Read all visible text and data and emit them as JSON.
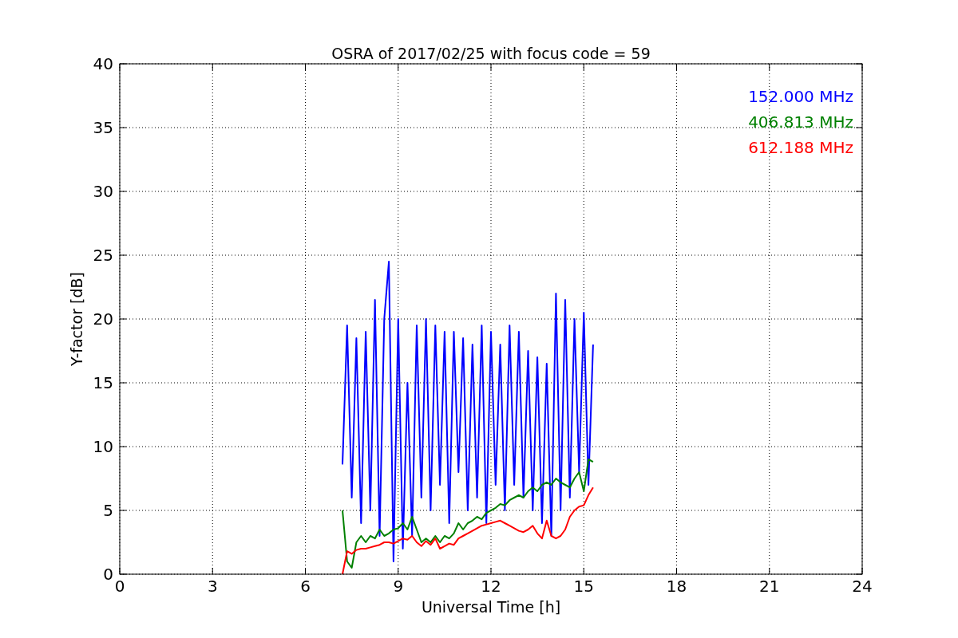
{
  "chart_data": {
    "type": "line",
    "title": "OSRA of 2017/02/25 with focus code = 59",
    "xlabel": "Universal Time [h]",
    "ylabel": "Y-factor [dB]",
    "x": [
      7.2,
      7.35,
      7.5,
      7.65,
      7.8,
      7.95,
      8.1,
      8.25,
      8.4,
      8.55,
      8.7,
      8.85,
      9,
      9.15,
      9.3,
      9.45,
      9.6,
      9.75,
      9.9,
      10.05,
      10.2,
      10.35,
      10.5,
      10.65,
      10.8,
      10.95,
      11.1,
      11.25,
      11.4,
      11.55,
      11.7,
      11.85,
      12,
      12.15,
      12.3,
      12.45,
      12.6,
      12.75,
      12.9,
      13.05,
      13.2,
      13.35,
      13.5,
      13.65,
      13.8,
      13.95,
      14.1,
      14.25,
      14.4,
      14.55,
      14.7,
      14.85,
      15,
      15.15,
      15.3
    ],
    "series": [
      {
        "name": "152.000 MHz",
        "color": "#0000ff",
        "values": [
          8.6,
          19.5,
          6,
          18.5,
          4,
          19,
          5,
          21.5,
          3,
          20,
          24.5,
          1,
          20,
          2,
          15,
          3,
          19.5,
          6,
          20,
          5,
          19.5,
          7,
          19,
          4,
          19,
          8,
          18.5,
          5,
          18,
          6,
          19.5,
          4,
          19,
          7,
          18,
          5,
          19.5,
          7,
          19,
          6,
          17.5,
          5,
          17,
          4,
          16.5,
          3,
          22,
          5,
          21.5,
          6,
          20,
          8,
          20.5,
          7,
          18
        ]
      },
      {
        "name": "406.813 MHz",
        "color": "#008000",
        "values": [
          5,
          1,
          0.5,
          2.5,
          3,
          2.5,
          3,
          2.8,
          3.5,
          3,
          3.2,
          3.5,
          3.6,
          4,
          3.5,
          4.5,
          3.5,
          2.5,
          2.8,
          2.5,
          3,
          2.5,
          3,
          2.8,
          3.2,
          4,
          3.5,
          4,
          4.2,
          4.5,
          4.3,
          4.8,
          5,
          5.2,
          5.5,
          5.4,
          5.8,
          6,
          6.2,
          6,
          6.5,
          6.8,
          6.5,
          7,
          7.2,
          7,
          7.5,
          7.2,
          7,
          6.8,
          7.5,
          8,
          6.5,
          9,
          8.8
        ]
      },
      {
        "name": "612.188 MHz",
        "color": "#ff0000",
        "values": [
          0,
          1.8,
          1.6,
          1.9,
          2,
          2,
          2.1,
          2.2,
          2.3,
          2.5,
          2.5,
          2.4,
          2.6,
          2.8,
          2.7,
          3,
          2.5,
          2.2,
          2.6,
          2.3,
          2.8,
          2,
          2.2,
          2.4,
          2.3,
          2.8,
          3,
          3.2,
          3.4,
          3.6,
          3.8,
          3.9,
          4,
          4.1,
          4.2,
          4,
          3.8,
          3.6,
          3.4,
          3.3,
          3.5,
          3.8,
          3.2,
          2.8,
          4.2,
          3,
          2.8,
          3,
          3.5,
          4.5,
          5,
          5.3,
          5.4,
          6.2,
          6.8
        ]
      }
    ],
    "xlim": [
      0,
      24
    ],
    "ylim": [
      0,
      40
    ],
    "xticks": [
      0,
      3,
      6,
      9,
      12,
      15,
      18,
      21,
      24
    ],
    "yticks": [
      0,
      5,
      10,
      15,
      20,
      25,
      30,
      35,
      40
    ],
    "grid": true
  }
}
